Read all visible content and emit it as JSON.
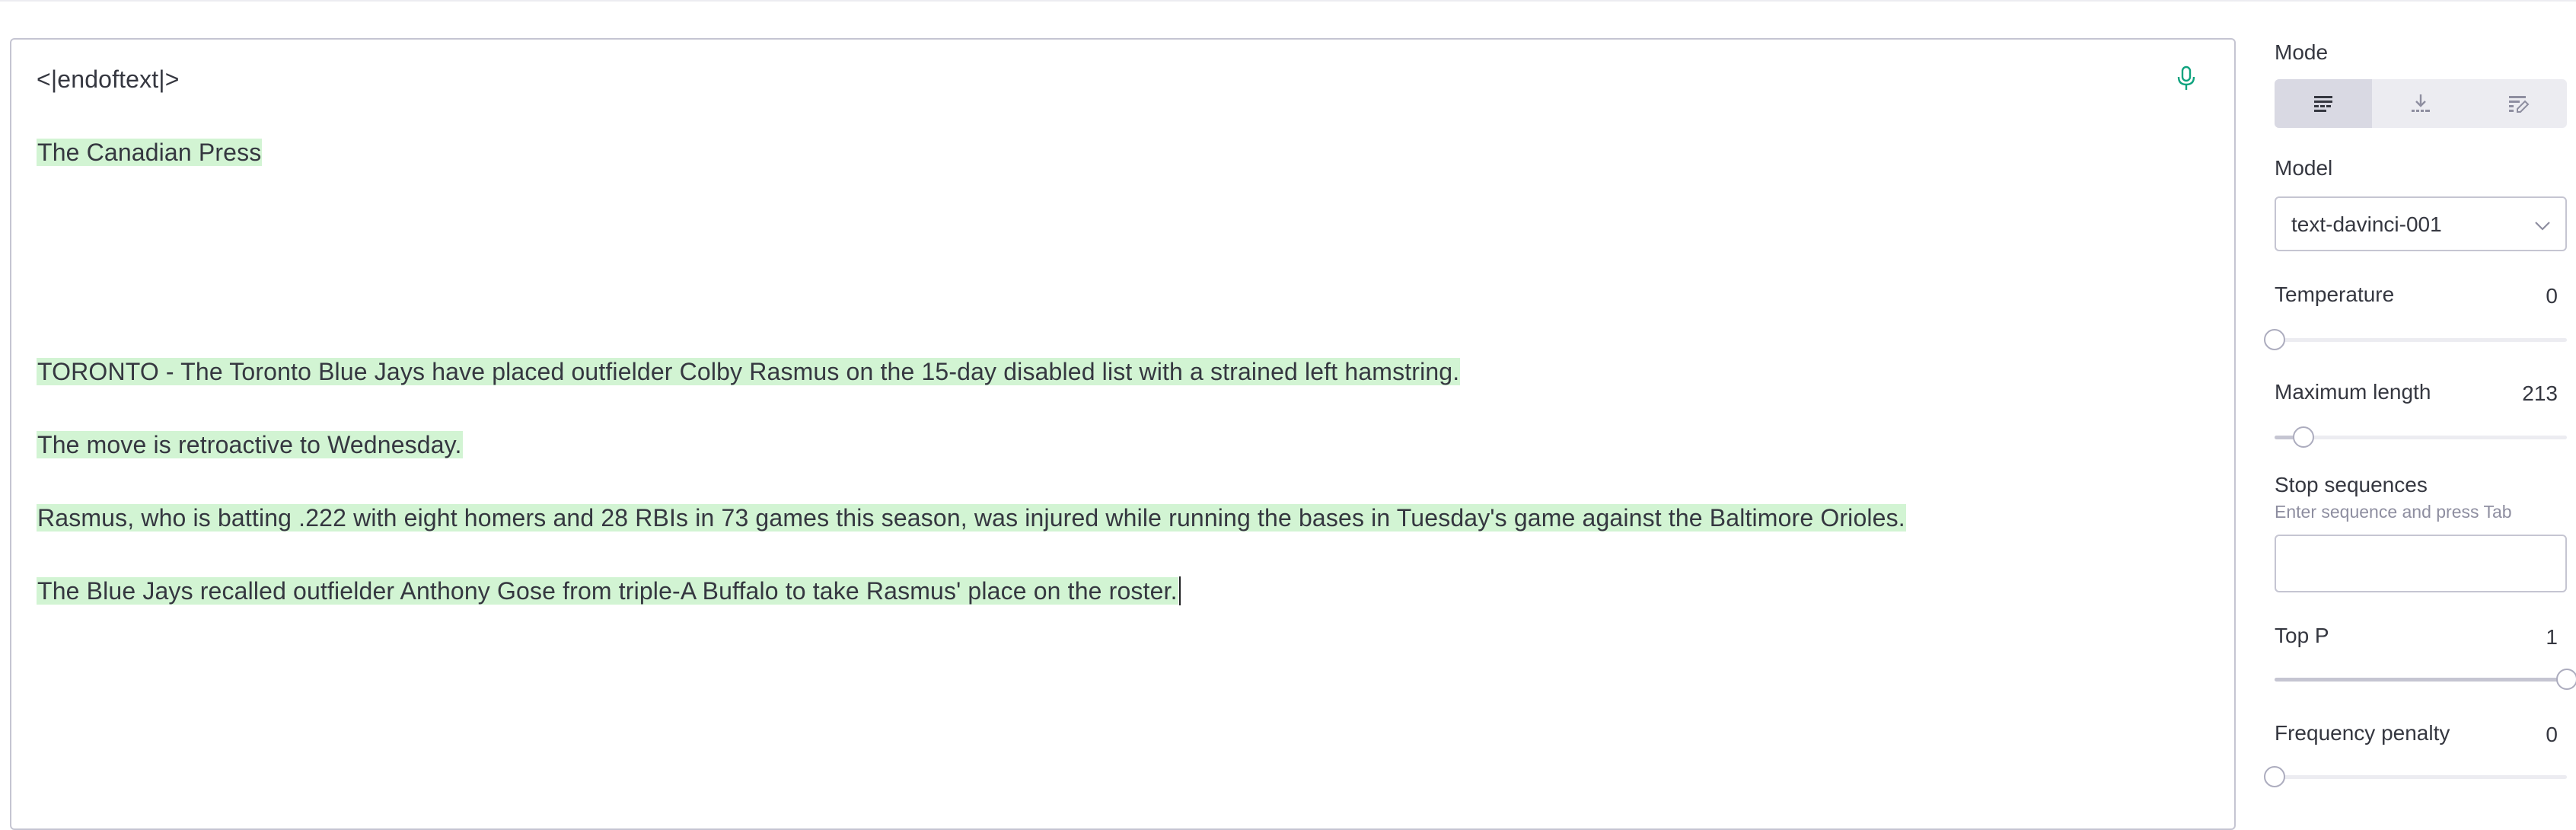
{
  "editor": {
    "lines": [
      "<|endoftext|>",
      "The Canadian Press",
      "TORONTO - The Toronto Blue Jays have placed outfielder Colby Rasmus on the 15-day disabled list with a strained left hamstring.",
      "The move is retroactive to Wednesday.",
      "Rasmus, who is batting .222 with eight homers and 28 RBIs in 73 games this season, was injured while running the bases in Tuesday's game against the Baltimore Orioles.",
      "The Blue Jays recalled outfielder Anthony Gose from triple-A Buffalo to take Rasmus' place on the roster."
    ],
    "mic_icon": "microphone-icon"
  },
  "sidebar": {
    "mode": {
      "label": "Mode",
      "options": [
        {
          "icon": "complete-mode-icon",
          "active": true
        },
        {
          "icon": "insert-mode-icon",
          "active": false
        },
        {
          "icon": "edit-mode-icon",
          "active": false
        }
      ]
    },
    "model": {
      "label": "Model",
      "value": "text-davinci-001",
      "icon": "chevron-down-icon"
    },
    "temperature": {
      "label": "Temperature",
      "value": "0",
      "fraction": 0.0
    },
    "max_length": {
      "label": "Maximum length",
      "value": "213",
      "fraction": 0.1
    },
    "stop_sequences": {
      "label": "Stop sequences",
      "hint": "Enter sequence and press Tab",
      "value": ""
    },
    "top_p": {
      "label": "Top P",
      "value": "1",
      "fraction": 1.0
    },
    "frequency_penalty": {
      "label": "Frequency penalty",
      "value": "0",
      "fraction": 0.0
    }
  },
  "colors": {
    "highlight": "#d2f4d3",
    "accent": "#10a37f",
    "border": "#c5c5d2"
  }
}
